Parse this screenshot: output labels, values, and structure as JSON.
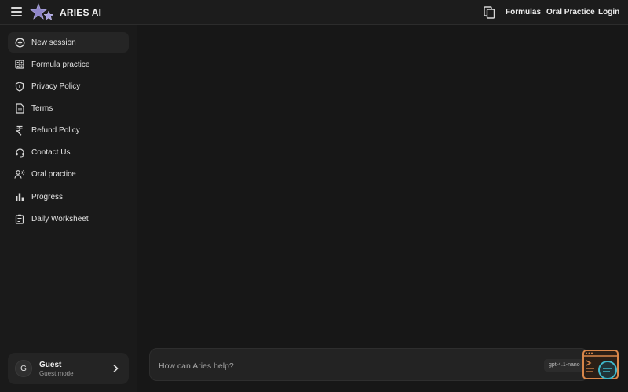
{
  "header": {
    "brand": "ARIES AI",
    "nav": [
      "Formulas",
      "Oral Practice",
      "Login"
    ]
  },
  "sidebar": {
    "items": [
      {
        "label": "New session",
        "icon": "plus-circle-icon"
      },
      {
        "label": "Formula practice",
        "icon": "calculator-icon"
      },
      {
        "label": "Privacy Policy",
        "icon": "shield-icon"
      },
      {
        "label": "Terms",
        "icon": "document-icon"
      },
      {
        "label": "Refund Policy",
        "icon": "rupee-icon"
      },
      {
        "label": "Contact Us",
        "icon": "headset-icon"
      },
      {
        "label": "Oral practice",
        "icon": "speaking-person-icon"
      },
      {
        "label": "Progress",
        "icon": "bar-chart-icon"
      },
      {
        "label": "Daily Worksheet",
        "icon": "clipboard-icon"
      }
    ],
    "user": {
      "initial": "G",
      "name": "Guest",
      "mode": "Guest mode"
    }
  },
  "chat": {
    "placeholder": "How can Aries help?",
    "model": "gpt-4.1-nano"
  },
  "colors": {
    "background": "#181818",
    "sidebar": "#1a1a1a",
    "accent_orange": "#d9874a",
    "accent_teal": "#3fb7c9"
  }
}
